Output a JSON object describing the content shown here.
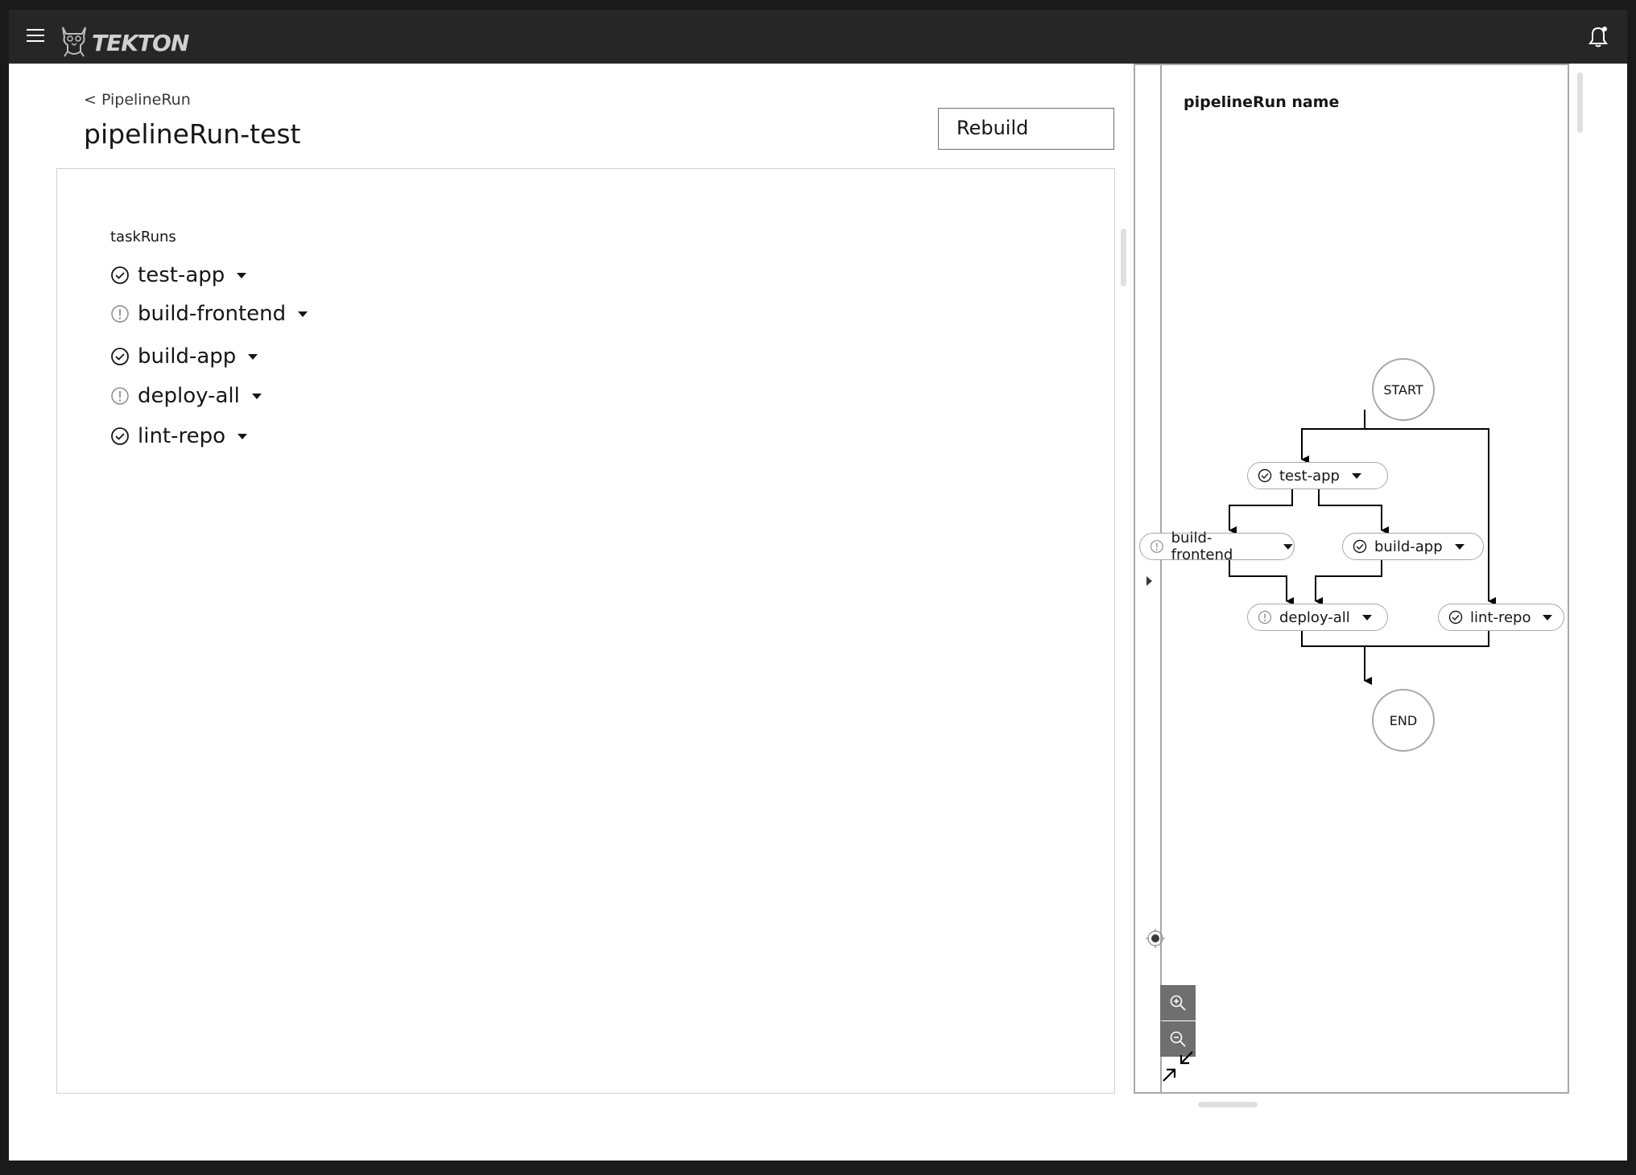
{
  "header": {
    "brand": "TEKTON",
    "menu_icon": "hamburger-icon",
    "logo_icon": "tekton-cat-logo-icon",
    "notification_icon": "bell-icon"
  },
  "page": {
    "back_link": "< PipelineRun",
    "title": "pipelineRun-test",
    "rebuild_label": "Rebuild"
  },
  "task_runs": {
    "label": "taskRuns",
    "items": [
      {
        "name": "test-app",
        "status": "success"
      },
      {
        "name": "build-frontend",
        "status": "warning"
      },
      {
        "name": "build-app",
        "status": "success"
      },
      {
        "name": "deploy-all",
        "status": "warning"
      },
      {
        "name": "lint-repo",
        "status": "success"
      }
    ]
  },
  "side_panel": {
    "title": "pipelineRun name",
    "graph": {
      "start_label": "START",
      "end_label": "END",
      "nodes": [
        {
          "name": "test-app",
          "status": "success"
        },
        {
          "name": "build-frontend",
          "status": "warning"
        },
        {
          "name": "build-app",
          "status": "success"
        },
        {
          "name": "deploy-all",
          "status": "warning"
        },
        {
          "name": "lint-repo",
          "status": "success"
        }
      ]
    },
    "controls": {
      "recenter_icon": "recenter-icon",
      "zoom_in_icon": "zoom-in-icon",
      "zoom_out_icon": "zoom-out-icon",
      "fit_icon": "collapse-arrows-icon"
    }
  },
  "colors": {
    "topbar": "#262626",
    "text": "#161616",
    "border": "#a8a8a8",
    "control_bg": "#6f6f6f"
  }
}
